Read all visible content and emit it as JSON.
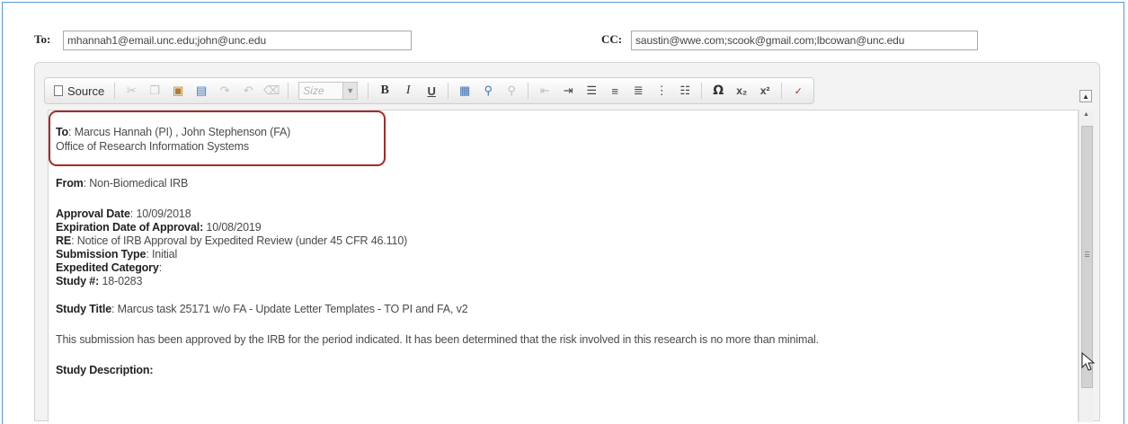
{
  "header": {
    "to_label": "To:",
    "to_value": "mhannah1@email.unc.edu;john@unc.edu",
    "cc_label": "CC:",
    "cc_value": "saustin@wwe.com;scook@gmail.com;lbcowan@unc.edu"
  },
  "toolbar": {
    "source_label": "Source",
    "size_placeholder": "Size",
    "bold_label": "B",
    "italic_label": "I",
    "underline_label": "U",
    "omega_label": "Ω",
    "subscript_label": "x₂",
    "superscript_label": "x²"
  },
  "letter": {
    "to_key": "To",
    "to_value": ": Marcus Hannah (PI) , John Stephenson (FA)",
    "office": "Office of Research Information Systems",
    "from_key": "From",
    "from_value": ": Non-Biomedical IRB",
    "approval_key": "Approval Date",
    "approval_value": ": 10/09/2018",
    "expiration_key": "Expiration Date of Approval:",
    "expiration_value": " 10/08/2019",
    "re_key": "RE",
    "re_value": ": Notice of IRB Approval by Expedited Review (under 45 CFR 46.110)",
    "submission_key": "Submission Type",
    "submission_value": ": Initial",
    "expedited_key": "Expedited Category",
    "expedited_value": ":",
    "study_no_key": "Study #:",
    "study_no_value": " 18-0283",
    "title_key": "Study Title",
    "title_value": ": Marcus task 25171 w/o FA - Update Letter Templates - TO PI and FA, v2",
    "approval_sentence": "This submission has been approved by the IRB for the period indicated. It has been determined that the risk involved in this research is no more than minimal.",
    "description_heading": "Study Description:"
  },
  "colors": {
    "frame_border": "#5b9bd5",
    "highlight_border": "#a52a2a",
    "editor_bg": "#f3f3f3"
  }
}
